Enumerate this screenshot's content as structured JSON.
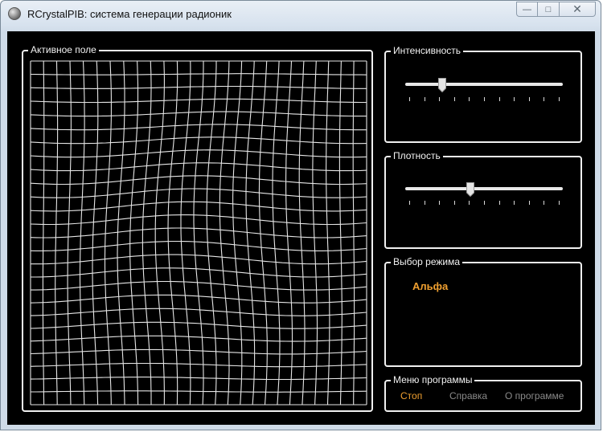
{
  "window": {
    "title": "RCrystalPIB: система генерации радионик",
    "minimize_symbol": "—",
    "maximize_symbol": "□",
    "close_symbol": "✕"
  },
  "active_field": {
    "label": "Активное поле"
  },
  "intensity": {
    "label": "Интенсивность",
    "value": 0.22,
    "tick_count": 11
  },
  "density": {
    "label": "Плотность",
    "value": 0.41,
    "tick_count": 11
  },
  "mode": {
    "label": "Выбор режима",
    "selected": "Альфа"
  },
  "menu": {
    "label": "Меню программы",
    "stop": "Стоп",
    "help": "Справка",
    "about": "О программе"
  },
  "colors": {
    "background": "#000000",
    "border": "#f0f0f0",
    "accent": "#f0a030",
    "menu_disabled": "#8a8a8a"
  },
  "icons": {
    "app": "crystal-ball-icon"
  }
}
